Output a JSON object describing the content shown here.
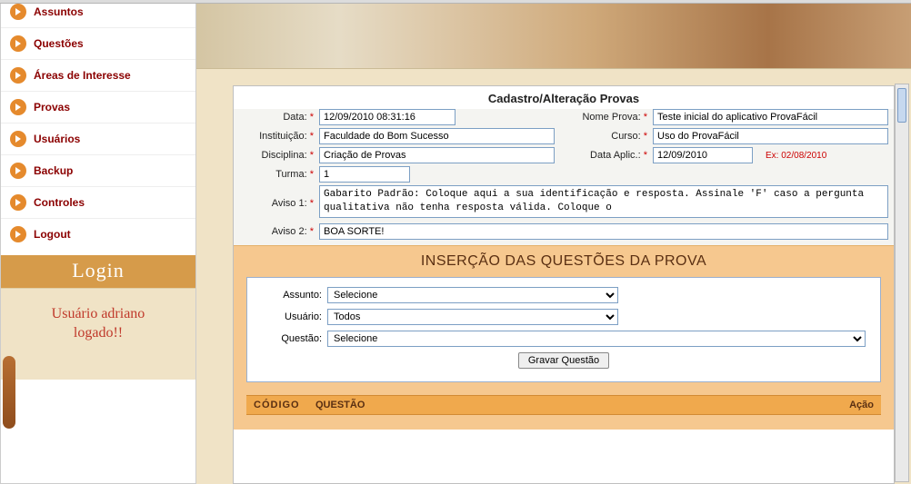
{
  "sidebar": {
    "items": [
      {
        "label": "Assuntos"
      },
      {
        "label": "Questões"
      },
      {
        "label": "Áreas de Interesse"
      },
      {
        "label": "Provas"
      },
      {
        "label": "Usuários"
      },
      {
        "label": "Backup"
      },
      {
        "label": "Controles"
      },
      {
        "label": "Logout"
      }
    ],
    "login_title": "Login",
    "logged_line1": "Usuário adriano",
    "logged_line2": "logado!!"
  },
  "panel": {
    "title": "Cadastro/Alteração Provas",
    "labels": {
      "data": "Data:",
      "nome_prova": "Nome Prova:",
      "instituicao": "Instituição:",
      "curso": "Curso:",
      "disciplina": "Disciplina:",
      "data_aplic": "Data Aplic.:",
      "turma": "Turma:",
      "aviso1": "Aviso 1:",
      "aviso2": "Aviso 2:"
    },
    "values": {
      "data": "12/09/2010 08:31:16",
      "nome_prova": "Teste inicial do aplicativo ProvaFácil",
      "instituicao": "Faculdade do Bom Sucesso",
      "curso": "Uso do ProvaFácil",
      "disciplina": "Criação de Provas",
      "data_aplic": "12/09/2010",
      "data_aplic_hint": "Ex: 02/08/2010",
      "turma": "1",
      "aviso1": "Gabarito Padrão: Coloque aqui a sua identificação e resposta. Assinale 'F' caso a pergunta qualitativa não tenha resposta válida. Coloque o",
      "aviso2": "BOA SORTE!"
    }
  },
  "insert": {
    "title": "INSERÇÃO DAS QUESTÕES DA PROVA",
    "labels": {
      "assunto": "Assunto:",
      "usuario": "Usuário:",
      "questao": "Questão:"
    },
    "opts": {
      "assunto": "Selecione",
      "usuario": "Todos",
      "questao": "Selecione"
    },
    "save_btn": "Gravar Questão"
  },
  "table": {
    "col1": "CÓDIGO",
    "col2": "QUESTÃO",
    "col3": "Ação"
  }
}
